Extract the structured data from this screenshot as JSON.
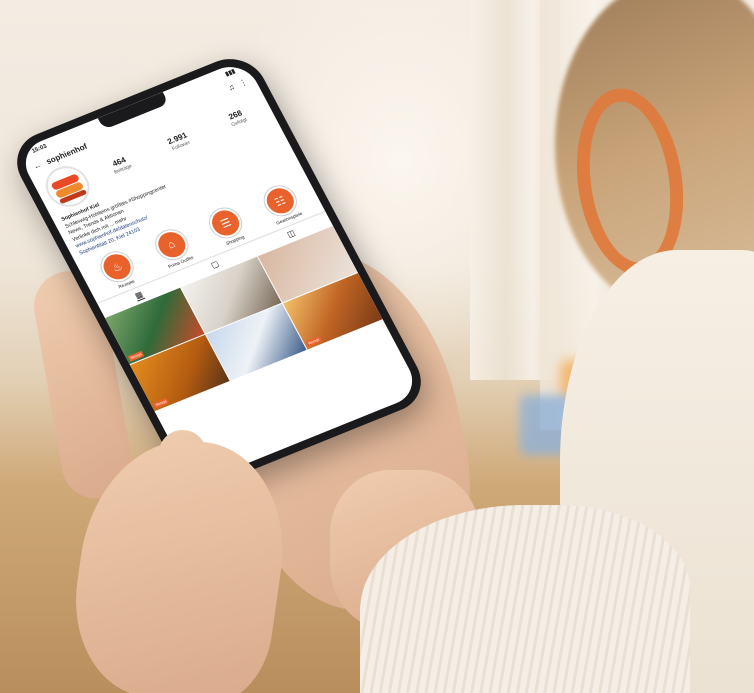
{
  "status_bar": {
    "time": "15:03",
    "signal": "▮▮▮"
  },
  "profile": {
    "username": "sophienhof",
    "stats": [
      {
        "value": "464",
        "label": "Beiträge"
      },
      {
        "value": "2.991",
        "label": "Follower"
      },
      {
        "value": "268",
        "label": "Gefolgt"
      }
    ],
    "bio": {
      "name": "Sophienhof Kiel",
      "line1": "Schleswig-Holsteins größtes #Shoppingcenter",
      "line2": "News, Trends & Aktionen",
      "line3": "Verlinke dich mit ... mehr",
      "link": "www.sophienhof.de/datenschutz/",
      "address": "Sophienblatt 20, Kiel 24103"
    }
  },
  "highlights": [
    {
      "label": "Rezepte",
      "icon": "chef-hat-icon",
      "glyph": "♨"
    },
    {
      "label": "Prima Outfits",
      "icon": "hanger-icon",
      "glyph": "⌂"
    },
    {
      "label": "Shopping",
      "icon": "bag-icon",
      "glyph": "☰"
    },
    {
      "label": "Gewinnspiele",
      "icon": "gift-icon",
      "glyph": "☷"
    }
  ],
  "tabs": [
    {
      "name": "grid",
      "icon": "grid-icon",
      "glyph": "▦"
    },
    {
      "name": "reels",
      "icon": "reels-icon",
      "glyph": "▢"
    },
    {
      "name": "tagged",
      "icon": "tagged-icon",
      "glyph": "◫"
    }
  ],
  "posts": [
    {
      "tag": "Rezept"
    },
    {
      "tag": ""
    },
    {
      "tag": ""
    },
    {
      "tag": "Rezept"
    },
    {
      "tag": ""
    },
    {
      "tag": "Rezept"
    }
  ],
  "colors": {
    "accent": "#e9622c",
    "link": "#1b3a7a"
  }
}
